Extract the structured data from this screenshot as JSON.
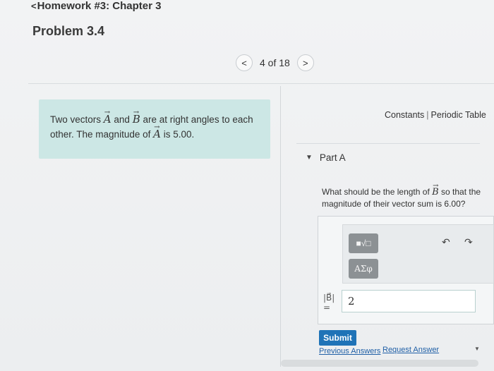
{
  "header": {
    "back_chevron": "<",
    "title": "Homework #3: Chapter 3"
  },
  "problem": {
    "title": "Problem 3.4",
    "statement_part1": "Two vectors",
    "vec_a": "A",
    "and": "and",
    "vec_b": "B",
    "statement_part2": "are at right angles to each other. The magnitude of",
    "statement_part3": "is 5.00."
  },
  "pager": {
    "prev_symbol": "<",
    "count_text": "4 of 18",
    "next_symbol": ">"
  },
  "links": {
    "constants": "Constants",
    "separator": "|",
    "periodic_table": "Periodic Table"
  },
  "part": {
    "label": "Part A",
    "caret_icon": "caret-down-icon",
    "question_part1": "What should be the length of",
    "question_vec": "B",
    "question_part2": "so that the magnitude of their vector sum is 6.00?"
  },
  "toolbar": {
    "templates_glyph": "■√□",
    "symbols_glyph": "ΑΣφ",
    "undo_glyph": "↶",
    "redo_glyph": "↷"
  },
  "answer": {
    "variable_label": "|B⃗|",
    "equals": "=",
    "value": "2"
  },
  "actions": {
    "submit": "Submit",
    "previous_answers": "Previous Answers",
    "request_answer": "Request Answer"
  },
  "colors": {
    "problem_box": "#cce7e5",
    "submit": "#1f73b7",
    "link": "#1f5fa6"
  }
}
